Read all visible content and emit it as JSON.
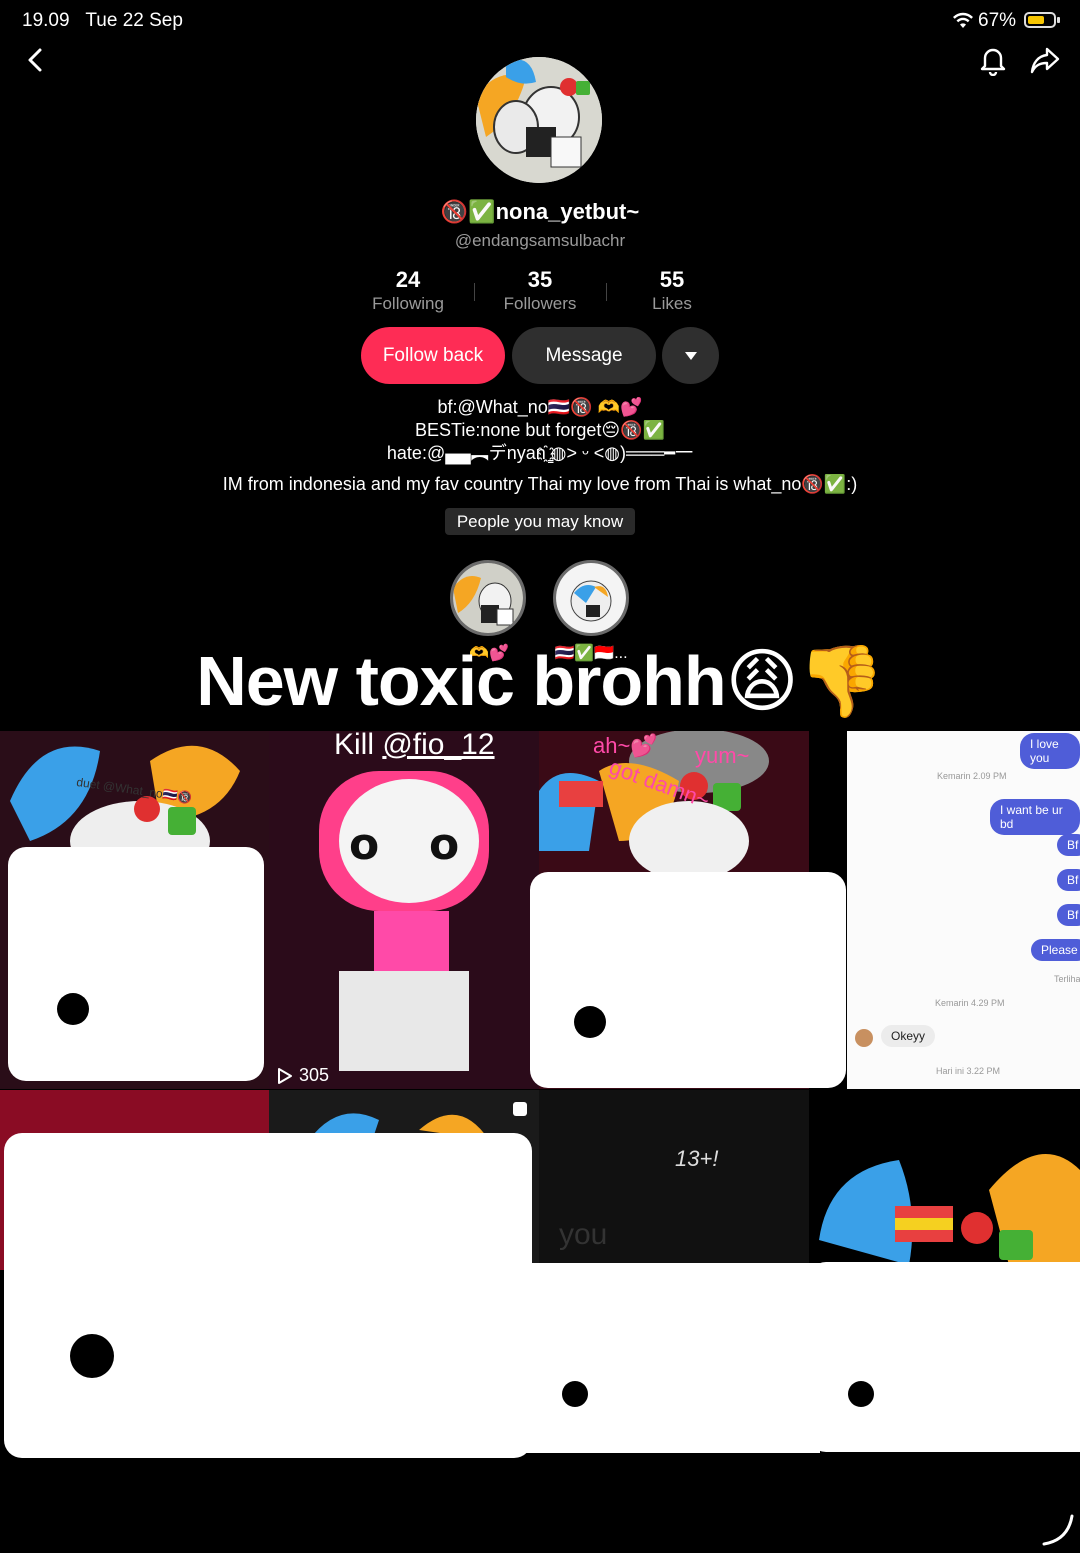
{
  "status": {
    "time": "19.09",
    "date": "Tue 22 Sep",
    "battery_pct": "67%",
    "battery_level": 0.67
  },
  "profile": {
    "display_name": "🔞✅nona_yetbut~",
    "username": "@endangsamsulbachr",
    "stats": [
      {
        "value": "24",
        "label": "Following"
      },
      {
        "value": "35",
        "label": "Followers"
      },
      {
        "value": "55",
        "label": "Likes"
      }
    ],
    "buttons": {
      "follow": "Follow back",
      "message": "Message"
    },
    "bio_lines": [
      "bf:@What_no🇹🇭🔞 🫶💕",
      "BESTie:none but forget😔🔞✅",
      "hate:@▄▄︻デnyan҈ ̳◍˃ ᵕ ˂◍)═══━一",
      "IM from indonesia and my fav country Thai my love from Thai is what_no🔞✅:)"
    ],
    "people_pill": "People you may know",
    "suggestions": [
      {
        "label": "🫶💕"
      },
      {
        "label": "🇹🇭✅🇮🇩..."
      }
    ]
  },
  "overlay_title": "New toxic brohh😩👎",
  "grid": {
    "kill_prefix": "Kill ",
    "kill_handle": "@fio_12",
    "tile2_views": "305",
    "tile1_caption": "duet @What_no🇹🇭🔞",
    "tile3_text": "ah~💕",
    "tile3_text2": "yum~",
    "tile3_text3": "got damn~",
    "tile8_text": "13+!",
    "tile7_text": "you",
    "chat": {
      "top_bubble": "I love you",
      "time1": "Kemarin 2.09 PM",
      "bubble2": "I want be ur bd",
      "bf1": "Bf",
      "bf2": "Bf",
      "bf3": "Bf",
      "please": "Please",
      "read": "Terliha",
      "time2": "Kemarin 4.29 PM",
      "reply": "Okeyy",
      "time3": "Hari ini 3.22 PM"
    }
  },
  "colors": {
    "accent": "#fe2c55",
    "bg": "#000000",
    "muted": "#9a9a9a"
  }
}
